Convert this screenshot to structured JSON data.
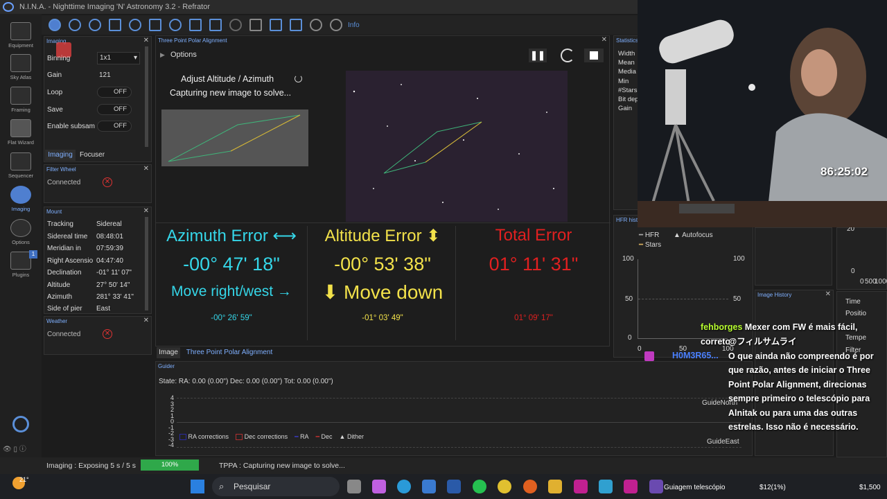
{
  "app": {
    "title": "N.I.N.A. - Nighttime Imaging 'N' Astronomy 3.2 - Refrator"
  },
  "sidebar": {
    "items": [
      "Equipment",
      "Sky Atlas",
      "Framing",
      "Flat Wizard",
      "Sequencer",
      "Imaging",
      "Options",
      "Plugins"
    ],
    "plugins_badge": "1",
    "collapse": "< <"
  },
  "toolbar": {
    "info": "Info"
  },
  "imaging_panel": {
    "title": "Imaging",
    "binning_label": "Binning",
    "binning_value": "1x1",
    "gain_label": "Gain",
    "gain_value": "121",
    "loop_label": "Loop",
    "loop_value": "OFF",
    "save_label": "Save",
    "save_value": "OFF",
    "subsample_label": "Enable subsam",
    "subsample_value": "OFF",
    "tabs": [
      "Imaging",
      "Focuser"
    ]
  },
  "filter_wheel": {
    "title": "Filter Wheel",
    "status": "Connected"
  },
  "mount": {
    "title": "Mount",
    "rows": [
      [
        "Tracking",
        "Sidereal"
      ],
      [
        "Sidereal time",
        "08:48:01"
      ],
      [
        "Meridian in",
        "07:59:39"
      ],
      [
        "Right Ascensio",
        "04:47:40"
      ],
      [
        "Declination",
        "-01° 11' 07\""
      ],
      [
        "Altitude",
        "27° 50' 14\""
      ],
      [
        "Azimuth",
        "281° 33' 41\""
      ],
      [
        "Side of pier",
        "East"
      ]
    ]
  },
  "weather": {
    "title": "Weather",
    "status": "Connected"
  },
  "tppa": {
    "title": "Three Point Polar Alignment",
    "options": "Options",
    "step": "Adjust Altitude / Azimuth",
    "status": "Capturing new image to solve...",
    "azimuth": {
      "label": "Azimuth Error ⟷",
      "value": "-00° 47' 18\"",
      "move": "Move right/west →",
      "small": "-00° 26' 59\""
    },
    "altitude": {
      "label": "Altitude Error ⬍",
      "value": "-00° 53' 38\"",
      "move": "⬇ Move down",
      "small": "-01° 03' 49\""
    },
    "total": {
      "label": "Total Error",
      "value": "01° 11' 31\"",
      "small": "01° 09' 17\""
    },
    "colors": {
      "azimuth": "#35d6e8",
      "altitude": "#f2e14a",
      "total": "#e02020"
    }
  },
  "doc_tabs": [
    "Image",
    "Three Point Polar Alignment"
  ],
  "statistics": {
    "title": "Statistics",
    "rows": [
      "Width",
      "Mean",
      "Media",
      "Min",
      "#Stars",
      "Bit dep",
      "Gain"
    ]
  },
  "hfr": {
    "title": "HFR histo",
    "legend": [
      "HFR",
      "Autofocus",
      "Stars"
    ],
    "y_ticks": [
      "100",
      "50",
      "0"
    ],
    "x_ticks": [
      "0",
      "50",
      "100"
    ],
    "right_ticks": [
      "100",
      "50"
    ]
  },
  "image_history": {
    "title": "Image History",
    "rows": [
      "Time",
      "Positio",
      "Tempe",
      "Filter"
    ]
  },
  "right_chart": {
    "ticks": [
      "20",
      "0",
      "0",
      "500",
      "1000"
    ]
  },
  "guider": {
    "title": "Guider",
    "state": "State:  RA: 0.00 (0.00\")  Dec: 0.00 (0.00\")  Tot: 0.00 (0.00\")",
    "y_ticks": [
      "4",
      "3",
      "2",
      "1",
      "0",
      "-1",
      "-2",
      "-3",
      "-4"
    ],
    "north": "GuideNorth",
    "east": "GuideEast",
    "legend": [
      "RA corrections",
      "Dec corrections",
      "RA",
      "Dec",
      "Dither"
    ]
  },
  "statusbar": {
    "imaging": "Imaging :   Exposing 5 s / 5 s",
    "progress": "100%",
    "tppa": "TPPA :   Capturing new image to solve..."
  },
  "overlay": {
    "timer": "86:25:02"
  },
  "chat": {
    "user": "fehborges",
    "lines": [
      "Mexer com FW é mais fácil, correto",
      "@フィルサムライ",
      "O que ainda não compreendo é por",
      "que razão, antes de iniciar o Three",
      "Point Polar Alignment, direcionas",
      "sempre primeiro o telescópio para",
      "Alnitak ou para uma das outras",
      "estrelas. Isso não é necessário."
    ],
    "other_user": "H0M3R65..."
  },
  "taskbar": {
    "weather": "21°",
    "search": "Pesquisar",
    "stream_title": "Guiagem telescópio",
    "price": "$12(1%)",
    "balance": "$1,500"
  }
}
